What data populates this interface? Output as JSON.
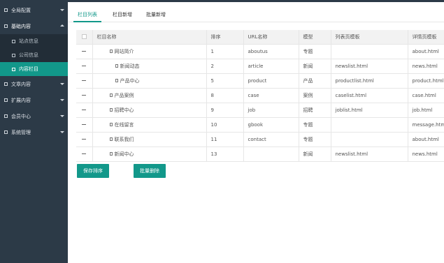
{
  "sidebar": {
    "groups": [
      {
        "label": "全局配置",
        "expanded": false
      },
      {
        "label": "基础内容",
        "expanded": true
      },
      {
        "label": "文章内容",
        "expanded": false
      },
      {
        "label": "扩展内容",
        "expanded": false
      },
      {
        "label": "会员中心",
        "expanded": false
      },
      {
        "label": "系统管理",
        "expanded": false
      }
    ],
    "sub_items": [
      {
        "label": "站点信息",
        "active": false
      },
      {
        "label": "公司信息",
        "active": false
      },
      {
        "label": "内容栏目",
        "active": true
      }
    ]
  },
  "tabs": [
    {
      "label": "栏目列表",
      "active": true
    },
    {
      "label": "栏目新增",
      "active": false
    },
    {
      "label": "批量新增",
      "active": false
    }
  ],
  "table": {
    "headers": [
      "",
      "栏目名称",
      "排序",
      "URL名称",
      "模型",
      "列表页模板",
      "详情页模板"
    ],
    "rows": [
      {
        "name": "网站简介",
        "sort": "1",
        "url": "aboutus",
        "model": "专题",
        "list_tpl": "",
        "detail_tpl": "about.html"
      },
      {
        "name": "新闻动态",
        "sort": "2",
        "url": "article",
        "model": "新闻",
        "list_tpl": "newslist.html",
        "detail_tpl": "news.html"
      },
      {
        "name": "产品中心",
        "sort": "5",
        "url": "product",
        "model": "产品",
        "list_tpl": "productlist.html",
        "detail_tpl": "product.html"
      },
      {
        "name": "产品案例",
        "sort": "8",
        "url": "case",
        "model": "案例",
        "list_tpl": "caselist.html",
        "detail_tpl": "case.html"
      },
      {
        "name": "招聘中心",
        "sort": "9",
        "url": "job",
        "model": "招聘",
        "list_tpl": "joblist.html",
        "detail_tpl": "job.html"
      },
      {
        "name": "在线留言",
        "sort": "10",
        "url": "gbook",
        "model": "专题",
        "list_tpl": "",
        "detail_tpl": "message.html"
      },
      {
        "name": "联系我们",
        "sort": "11",
        "url": "contact",
        "model": "专题",
        "list_tpl": "",
        "detail_tpl": "about.html"
      },
      {
        "name": "新闻中心",
        "sort": "13",
        "url": "",
        "model": "新闻",
        "list_tpl": "newslist.html",
        "detail_tpl": "news.html"
      }
    ]
  },
  "actions": {
    "save_label": "保存排序",
    "delete_label": "批量删除"
  },
  "colors": {
    "accent": "#12988a",
    "sidebar_bg": "#2c3a47",
    "sidebar_sub_bg": "#222d37"
  }
}
